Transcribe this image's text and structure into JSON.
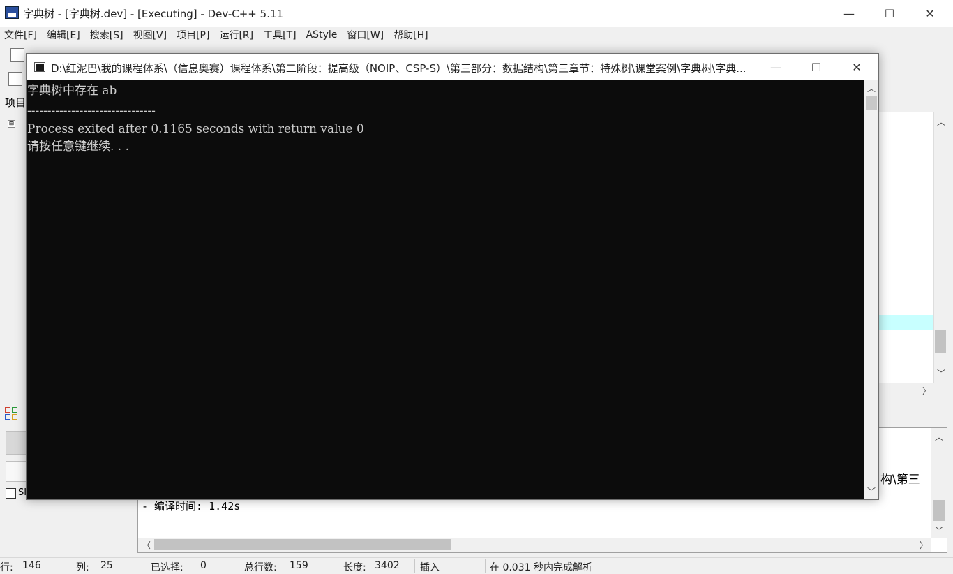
{
  "main_window": {
    "title": "字典树 - [字典树.dev] - [Executing] - Dev-C++ 5.11",
    "minimize": "—",
    "maximize": "☐",
    "close": "✕"
  },
  "menu": [
    "文件[F]",
    "编辑[E]",
    "搜索[S]",
    "视图[V]",
    "项目[P]",
    "运行[R]",
    "工具[T]",
    "AStyle",
    "窗口[W]",
    "帮助[H]"
  ],
  "project_panel": {
    "tab_label": "项目",
    "tree_toggle": "⊟"
  },
  "bottom_panel": {
    "checkbox_label": "SI",
    "log_line_1": "构\\第三",
    "log_line_2": "- 编译时间: 1.42s"
  },
  "status_bar": {
    "row_label": "行:",
    "row_value": "146",
    "col_label": "列:",
    "col_value": "25",
    "sel_label": "已选择:",
    "sel_value": "0",
    "lines_label": "总行数:",
    "lines_value": "159",
    "len_label": "长度:",
    "len_value": "3402",
    "mode": "插入",
    "parse_msg": "在 0.031 秒内完成解析"
  },
  "console": {
    "title": "D:\\红泥巴\\我的课程体系\\（信息奥赛）课程体系\\第二阶段：提高级（NOIP、CSP-S）\\第三部分：数据结构\\第三章节：特殊树\\课堂案例\\字典树\\字典...",
    "minimize": "—",
    "maximize": "☐",
    "close": "✕",
    "lines": [
      "字典树中存在 ab",
      "",
      "--------------------------------",
      "Process exited after 0.1165 seconds with return value 0",
      "请按任意键继续. . ."
    ]
  },
  "colors": {
    "console_bg": "#0c0c0c",
    "console_text": "#cccccc",
    "editor_highlight": "#c8ffff"
  }
}
